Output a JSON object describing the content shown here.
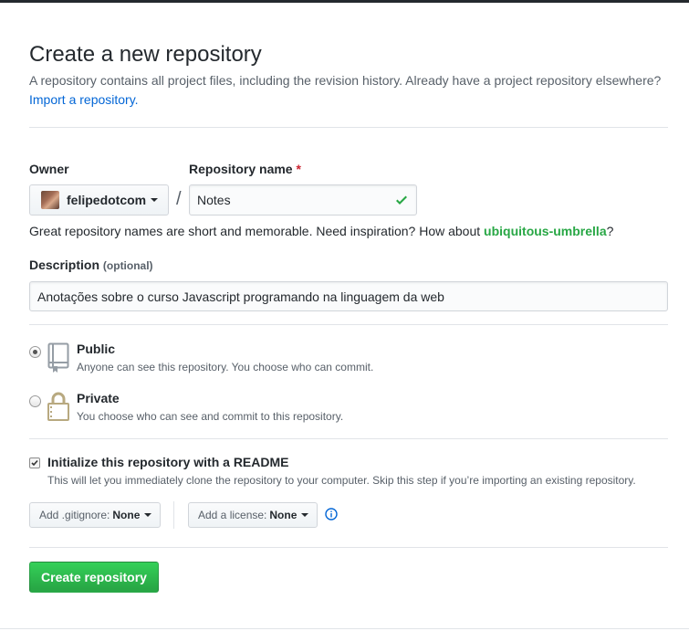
{
  "header": {
    "title": "Create a new repository",
    "subtitle": "A repository contains all project files, including the revision history. Already have a project repository elsewhere?",
    "import_link": "Import a repository."
  },
  "owner": {
    "label": "Owner",
    "value": "felipedotcom"
  },
  "repo_name": {
    "label": "Repository name",
    "required_mark": "*",
    "value": "Notes",
    "separator": "/"
  },
  "hint": {
    "text": "Great repository names are short and memorable. Need inspiration? How about",
    "suggestion": "ubiquitous-umbrella",
    "end": "?"
  },
  "description": {
    "label": "Description",
    "optional": "(optional)",
    "value": "Anotações sobre o curso Javascript programando na linguagem da web"
  },
  "visibility": {
    "public": {
      "title": "Public",
      "desc": "Anyone can see this repository. You choose who can commit.",
      "selected": true
    },
    "private": {
      "title": "Private",
      "desc": "You choose who can see and commit to this repository.",
      "selected": false
    }
  },
  "readme": {
    "label": "Initialize this repository with a README",
    "desc": "This will let you immediately clone the repository to your computer. Skip this step if you’re importing an existing repository.",
    "checked": true
  },
  "gitignore": {
    "prefix": "Add .gitignore:",
    "value": "None"
  },
  "license": {
    "prefix": "Add a license:",
    "value": "None"
  },
  "submit": {
    "label": "Create repository"
  },
  "colors": {
    "link": "#0366d6",
    "success": "#28a745",
    "required": "#cb2431",
    "muted": "#586069"
  },
  "icons": {
    "public": "repo-book-icon",
    "private": "lock-icon",
    "valid": "check-icon",
    "info": "info-icon"
  }
}
